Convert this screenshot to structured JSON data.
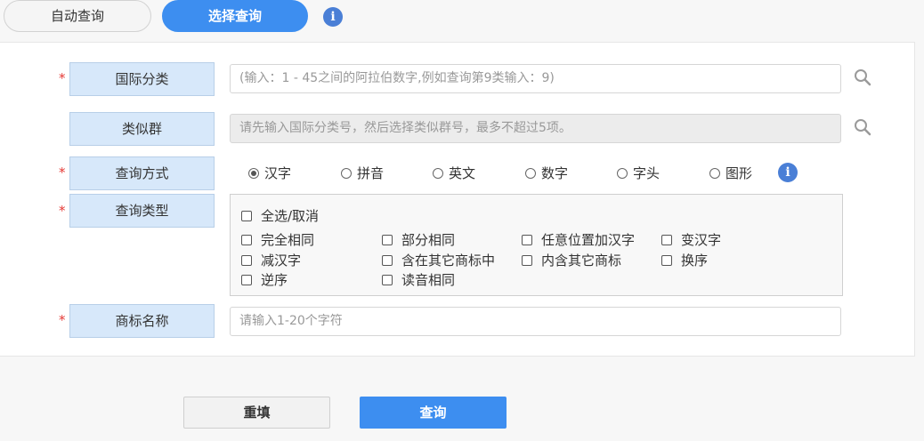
{
  "tabs": {
    "auto": "自动查询",
    "select": "选择查询"
  },
  "fields": {
    "intl_class": {
      "label": "国际分类",
      "placeholder": "(输入：1 - 45之间的阿拉伯数字,例如查询第9类输入：9)"
    },
    "similar_group": {
      "label": "类似群",
      "placeholder": "请先输入国际分类号，然后选择类似群号，最多不超过5项。"
    },
    "query_method": {
      "label": "查询方式",
      "options": [
        "汉字",
        "拼音",
        "英文",
        "数字",
        "字头",
        "图形"
      ],
      "selected": "汉字"
    },
    "query_type": {
      "label": "查询类型",
      "select_all": "全选/取消",
      "options": [
        "完全相同",
        "部分相同",
        "任意位置加汉字",
        "变汉字",
        "减汉字",
        "含在其它商标中",
        "内含其它商标",
        "换序",
        "逆序",
        "读音相同"
      ]
    },
    "trademark_name": {
      "label": "商标名称",
      "placeholder": "请输入1-20个字符"
    }
  },
  "required_mark": "*",
  "info_glyph": "i",
  "buttons": {
    "reset": "重填",
    "query": "查询"
  },
  "colors": {
    "accent": "#3d8ef0",
    "label_bg": "#d7e8fa",
    "required": "#e53935",
    "info": "#4a7fd6"
  }
}
